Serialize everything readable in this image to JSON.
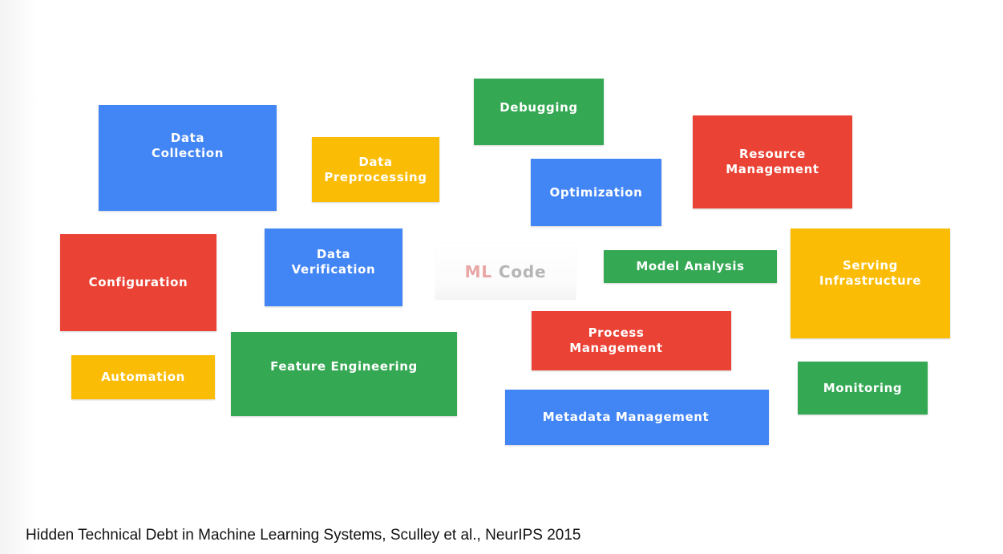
{
  "colors": {
    "blue": "#4285f4",
    "red": "#ea4335",
    "yellow": "#fbbc05",
    "green": "#34a853"
  },
  "boxes": {
    "data_collection": {
      "lines": [
        "Data",
        "Collection"
      ],
      "color": "blue"
    },
    "data_preprocessing": {
      "lines": [
        "Data",
        "Preprocessing"
      ],
      "color": "yellow"
    },
    "debugging": {
      "lines": [
        "Debugging"
      ],
      "color": "green"
    },
    "optimization": {
      "lines": [
        "Optimization"
      ],
      "color": "blue"
    },
    "resource_management": {
      "lines": [
        "Resource",
        "Management"
      ],
      "color": "red"
    },
    "configuration": {
      "lines": [
        "Configuration"
      ],
      "color": "red"
    },
    "data_verification": {
      "lines": [
        "Data",
        "Verification"
      ],
      "color": "blue"
    },
    "model_analysis": {
      "lines": [
        "Model Analysis"
      ],
      "color": "green"
    },
    "serving_infrastructure": {
      "lines": [
        "Serving",
        "Infrastructure"
      ],
      "color": "yellow"
    },
    "automation": {
      "lines": [
        "Automation"
      ],
      "color": "yellow"
    },
    "feature_engineering": {
      "lines": [
        "Feature Engineering"
      ],
      "color": "green"
    },
    "process_management": {
      "lines": [
        "Process",
        "Management"
      ],
      "color": "red"
    },
    "monitoring": {
      "lines": [
        "Monitoring"
      ],
      "color": "green"
    },
    "metadata_management": {
      "lines": [
        "Metadata Management"
      ],
      "color": "blue"
    }
  },
  "ml_code": {
    "ml": "ML",
    "code": "Code"
  },
  "caption": "Hidden Technical Debt in Machine Learning Systems, Sculley et al., NeurIPS 2015"
}
